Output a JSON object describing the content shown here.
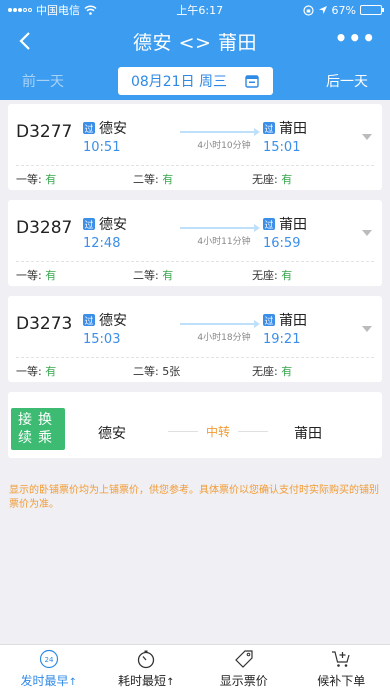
{
  "status_bar": {
    "carrier": "中国电信",
    "time": "上午6:17",
    "battery": "67%",
    "battery_level": 0.67
  },
  "header": {
    "title": "德安 <> 莆田",
    "back_icon": "chevron-left-icon",
    "more_label": "•••"
  },
  "date_bar": {
    "prev": "前一天",
    "date": "08月21日 周三",
    "next": "后一天"
  },
  "trains": [
    {
      "number": "D3277",
      "from": "德安",
      "to": "莆田",
      "via_label": "过",
      "depart": "10:51",
      "arrive": "15:01",
      "duration": "4小时10分钟",
      "seats": [
        {
          "label": "一等:",
          "value": "有"
        },
        {
          "label": "二等:",
          "value": "有"
        },
        {
          "label": "无座:",
          "value": "有"
        }
      ]
    },
    {
      "number": "D3287",
      "from": "德安",
      "to": "莆田",
      "via_label": "过",
      "depart": "12:48",
      "arrive": "16:59",
      "duration": "4小时11分钟",
      "seats": [
        {
          "label": "一等:",
          "value": "有"
        },
        {
          "label": "二等:",
          "value": "有"
        },
        {
          "label": "无座:",
          "value": "有"
        }
      ]
    },
    {
      "number": "D3273",
      "from": "德安",
      "to": "莆田",
      "via_label": "过",
      "depart": "15:03",
      "arrive": "19:21",
      "duration": "4小时18分钟",
      "seats": [
        {
          "label": "一等:",
          "value": "有"
        },
        {
          "label": "二等:",
          "value": "5张"
        },
        {
          "label": "无座:",
          "value": "有"
        }
      ]
    }
  ],
  "transfer": {
    "badge_line1": "接换",
    "badge_line2": "续乘",
    "from": "德安",
    "middle": "中转",
    "to": "莆田"
  },
  "notice": "显示的卧铺票价均为上铺票价，供您参考。具体票价以您确认支付时实际购买的铺别票价为准。",
  "tabs": [
    {
      "label": "发时最早",
      "icon": "clock-24-icon",
      "sort": "↑",
      "active": true
    },
    {
      "label": "耗时最短",
      "icon": "stopwatch-icon",
      "sort": "↑",
      "active": false
    },
    {
      "label": "显示票价",
      "icon": "price-tag-icon",
      "sort": "",
      "active": false
    },
    {
      "label": "候补下单",
      "icon": "cart-plus-icon",
      "sort": "",
      "active": false
    }
  ],
  "colors": {
    "primary": "#3c9cf0",
    "accent": "#2f8ae5",
    "available": "#39a84f",
    "transfer": "#3dbb73",
    "notice": "#f29b34"
  }
}
